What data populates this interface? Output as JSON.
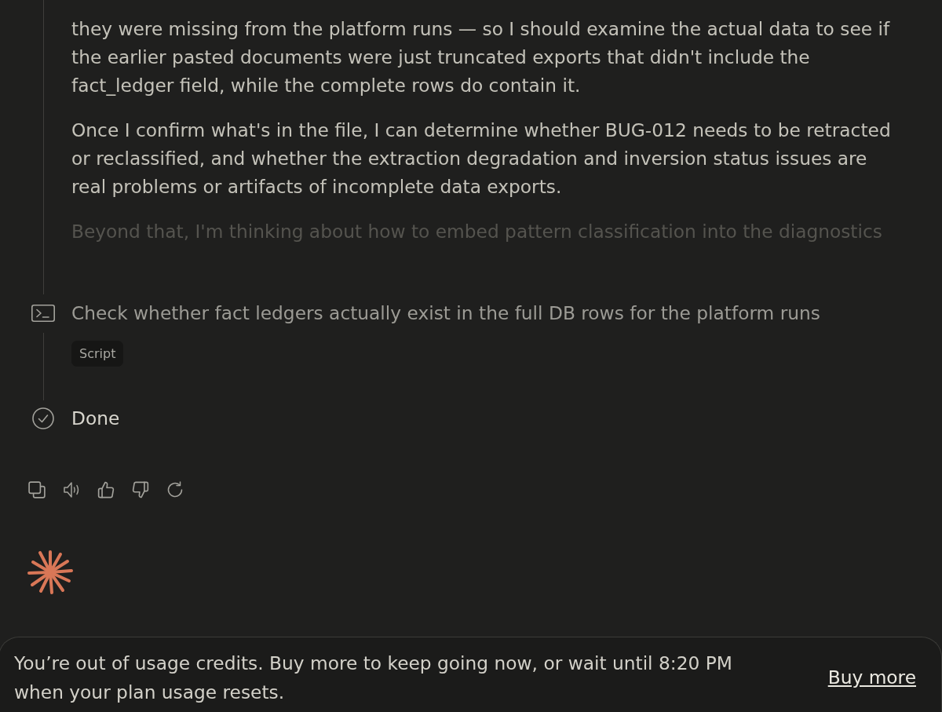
{
  "thinking": {
    "paragraphs": [
      {
        "text": "they were missing from the platform runs — so I should examine the actual data to see if the earlier pasted documents were just truncated exports that didn't include the fact_ledger field, while the complete rows do contain it.",
        "faded": false
      },
      {
        "text": "Once I confirm what's in the file, I can determine whether BUG-012 needs to be retracted or reclassified, and whether the extraction degradation and inversion status issues are real problems or artifacts of incomplete data exports.",
        "faded": false
      },
      {
        "text": "Beyond that, I'm thinking about how to embed pattern classification into the diagnostics",
        "faded": true
      }
    ]
  },
  "steps": [
    {
      "kind": "command",
      "text": "Check whether fact ledgers actually exist in the full DB rows for the platform runs",
      "tag": "Script"
    },
    {
      "kind": "done",
      "text": "Done"
    }
  ],
  "banner": {
    "message": "You’re out of usage credits. Buy more to keep going now, or wait until 8:20 PM when your plan usage resets.",
    "link": "Buy more"
  }
}
